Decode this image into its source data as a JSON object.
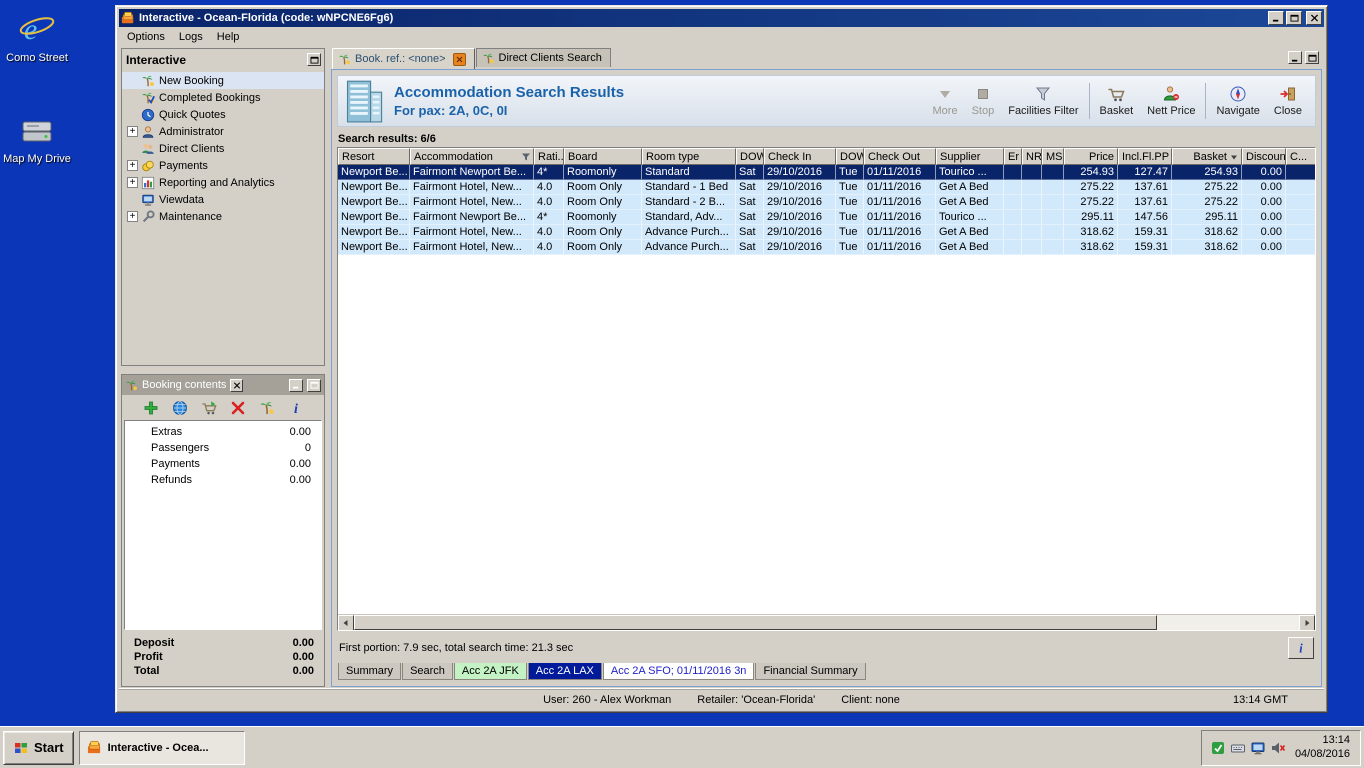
{
  "colors": {
    "desktop": "#0c36b8",
    "titlebar": "#0a246a",
    "selection": "#0a246a",
    "row_blue": "#d2e9fb",
    "header_blue": "#1a62aa"
  },
  "desktop": {
    "icons": [
      {
        "label": "Como Street",
        "name": "desktop-icon-como-street",
        "icon": "ie-icon"
      },
      {
        "label": "Map My Drive",
        "name": "desktop-icon-map-my-drive",
        "icon": "drive-icon"
      }
    ]
  },
  "window": {
    "title": "Interactive - Ocean-Florida (code: wNPCNE6Fg6)",
    "menu": [
      "Options",
      "Logs",
      "Help"
    ]
  },
  "sidebar": {
    "title": "Interactive",
    "items": [
      {
        "label": "New Booking",
        "name": "sidebar-item-new-booking",
        "icon": "new-booking-icon",
        "selected": true
      },
      {
        "label": "Completed Bookings",
        "name": "sidebar-item-completed-bookings",
        "icon": "completed-bookings-icon"
      },
      {
        "label": "Quick Quotes",
        "name": "sidebar-item-quick-quotes",
        "icon": "quick-quotes-icon"
      },
      {
        "label": "Administrator",
        "name": "sidebar-item-administrator",
        "icon": "administrator-icon",
        "expandable": true
      },
      {
        "label": "Direct Clients",
        "name": "sidebar-item-direct-clients",
        "icon": "direct-clients-icon"
      },
      {
        "label": "Payments",
        "name": "sidebar-item-payments",
        "icon": "payments-icon",
        "expandable": true
      },
      {
        "label": "Reporting and Analytics",
        "name": "sidebar-item-reporting-and-analytics",
        "icon": "reporting-icon",
        "expandable": true
      },
      {
        "label": "Viewdata",
        "name": "sidebar-item-viewdata",
        "icon": "viewdata-icon"
      },
      {
        "label": "Maintenance",
        "name": "sidebar-item-maintenance",
        "icon": "maintenance-icon",
        "expandable": true
      }
    ]
  },
  "booking_contents": {
    "title": "Booking contents",
    "toolbar": [
      {
        "icon": "add-icon",
        "name": "add-button"
      },
      {
        "icon": "world-icon",
        "name": "world-button"
      },
      {
        "icon": "basket-move-icon",
        "name": "move-to-basket-button"
      },
      {
        "icon": "delete-icon",
        "name": "delete-button"
      },
      {
        "icon": "palm-icon",
        "name": "palm-button"
      },
      {
        "icon": "info-icon",
        "name": "info-button"
      }
    ],
    "rows": [
      {
        "label": "Extras",
        "value": "0.00"
      },
      {
        "label": "Passengers",
        "value": "0"
      },
      {
        "label": "Payments",
        "value": "0.00"
      },
      {
        "label": "Refunds",
        "value": "0.00"
      }
    ],
    "totals": [
      {
        "label": "Deposit",
        "value": "0.00"
      },
      {
        "label": "Profit",
        "value": "0.00"
      },
      {
        "label": "Total",
        "value": "0.00"
      }
    ]
  },
  "tabs": [
    {
      "label": "Book. ref.: <none>",
      "name": "tab-booking-ref",
      "active": true,
      "closable": true
    },
    {
      "label": "Direct Clients Search",
      "name": "tab-direct-clients-search"
    }
  ],
  "results_header": {
    "title": "Accommodation Search Results",
    "subtitle": "For pax: 2A, 0C, 0I",
    "tools": [
      {
        "label": "More",
        "name": "more-button",
        "icon": "more-icon",
        "disabled": true
      },
      {
        "label": "Stop",
        "name": "stop-button",
        "icon": "stop-icon",
        "disabled": true
      },
      {
        "label": "Facilities Filter",
        "name": "facilities-filter-button",
        "icon": "filter-icon",
        "sep": true
      },
      {
        "label": "Basket",
        "name": "basket-button",
        "icon": "basket-icon"
      },
      {
        "label": "Nett Price",
        "name": "nett-price-button",
        "icon": "nett-price-icon",
        "sep": true
      },
      {
        "label": "Navigate",
        "name": "navigate-button",
        "icon": "navigate-icon"
      },
      {
        "label": "Close",
        "name": "close-search-button",
        "icon": "close-tool-icon"
      }
    ]
  },
  "results": {
    "count_label": "Search results: 6/6",
    "status": "First portion: 7.9 sec, total search time: 21.3 sec",
    "columns": [
      {
        "label": "Resort",
        "name": "col-resort"
      },
      {
        "label": "Accommodation",
        "name": "col-accommodation",
        "filter": true
      },
      {
        "label": "Rati...",
        "name": "col-rating"
      },
      {
        "label": "Board",
        "name": "col-board"
      },
      {
        "label": "Room type",
        "name": "col-room-type"
      },
      {
        "label": "DOW",
        "name": "col-dow-in"
      },
      {
        "label": "Check In",
        "name": "col-check-in"
      },
      {
        "label": "DOW",
        "name": "col-dow-out"
      },
      {
        "label": "Check Out",
        "name": "col-check-out"
      },
      {
        "label": "Supplier",
        "name": "col-supplier"
      },
      {
        "label": "Er",
        "name": "col-er"
      },
      {
        "label": "NR",
        "name": "col-nr"
      },
      {
        "label": "MS",
        "name": "col-ms"
      },
      {
        "label": "Price",
        "name": "col-price",
        "right": true
      },
      {
        "label": "Incl.Fl.PP",
        "name": "col-incl-fl-pp",
        "right": true
      },
      {
        "label": "Basket",
        "name": "col-basket",
        "right": true,
        "sort": true
      },
      {
        "label": "Discount",
        "name": "col-discount",
        "right": true
      },
      {
        "label": "C...",
        "name": "col-c"
      }
    ],
    "rows": [
      {
        "selected": true,
        "resort": "Newport Be...",
        "accommodation": "Fairmont Newport Be...",
        "rating": "4*",
        "board": "Roomonly",
        "room_type": "Standard",
        "dow_in": "Sat",
        "check_in": "29/10/2016",
        "dow_out": "Tue",
        "check_out": "01/11/2016",
        "supplier": "Tourico ...",
        "er": "",
        "nr": "",
        "ms": "",
        "price": "254.93",
        "incl_fl_pp": "127.47",
        "basket": "254.93",
        "discount": "0.00",
        "c": ""
      },
      {
        "resort": "Newport Be...",
        "accommodation": "Fairmont Hotel, New...",
        "rating": "4.0",
        "board": "Room Only",
        "room_type": "Standard - 1 Bed",
        "dow_in": "Sat",
        "check_in": "29/10/2016",
        "dow_out": "Tue",
        "check_out": "01/11/2016",
        "supplier": "Get A Bed",
        "er": "",
        "nr": "",
        "ms": "",
        "price": "275.22",
        "incl_fl_pp": "137.61",
        "basket": "275.22",
        "discount": "0.00",
        "c": ""
      },
      {
        "resort": "Newport Be...",
        "accommodation": "Fairmont Hotel, New...",
        "rating": "4.0",
        "board": "Room Only",
        "room_type": "Standard - 2 B...",
        "dow_in": "Sat",
        "check_in": "29/10/2016",
        "dow_out": "Tue",
        "check_out": "01/11/2016",
        "supplier": "Get A Bed",
        "er": "",
        "nr": "",
        "ms": "",
        "price": "275.22",
        "incl_fl_pp": "137.61",
        "basket": "275.22",
        "discount": "0.00",
        "c": ""
      },
      {
        "resort": "Newport Be...",
        "accommodation": "Fairmont Newport Be...",
        "rating": "4*",
        "board": "Roomonly",
        "room_type": "Standard, Adv...",
        "dow_in": "Sat",
        "check_in": "29/10/2016",
        "dow_out": "Tue",
        "check_out": "01/11/2016",
        "supplier": "Tourico ...",
        "er": "",
        "nr": "",
        "ms": "",
        "price": "295.11",
        "incl_fl_pp": "147.56",
        "basket": "295.11",
        "discount": "0.00",
        "c": ""
      },
      {
        "resort": "Newport Be...",
        "accommodation": "Fairmont Hotel, New...",
        "rating": "4.0",
        "board": "Room Only",
        "room_type": "Advance Purch...",
        "dow_in": "Sat",
        "check_in": "29/10/2016",
        "dow_out": "Tue",
        "check_out": "01/11/2016",
        "supplier": "Get A Bed",
        "er": "",
        "nr": "",
        "ms": "",
        "price": "318.62",
        "incl_fl_pp": "159.31",
        "basket": "318.62",
        "discount": "0.00",
        "c": ""
      },
      {
        "resort": "Newport Be...",
        "accommodation": "Fairmont Hotel, New...",
        "rating": "4.0",
        "board": "Room Only",
        "room_type": "Advance Purch...",
        "dow_in": "Sat",
        "check_in": "29/10/2016",
        "dow_out": "Tue",
        "check_out": "01/11/2016",
        "supplier": "Get A Bed",
        "er": "",
        "nr": "",
        "ms": "",
        "price": "318.62",
        "incl_fl_pp": "159.31",
        "basket": "318.62",
        "discount": "0.00",
        "c": ""
      }
    ]
  },
  "bottom_tabs": [
    {
      "label": "Summary",
      "name": "view-tab-summary",
      "style": "plain"
    },
    {
      "label": "Search",
      "name": "view-tab-search",
      "style": "plain"
    },
    {
      "label": "Acc 2A JFK",
      "name": "view-tab-acc-2a-jfk",
      "style": "green"
    },
    {
      "label": "Acc 2A LAX",
      "name": "view-tab-acc-2a-lax",
      "style": "navy"
    },
    {
      "label": "Acc 2A SFO; 01/11/2016 3n",
      "name": "view-tab-acc-2a-sfo",
      "style": "white"
    },
    {
      "label": "Financial Summary",
      "name": "view-tab-financial-summary",
      "style": "plain"
    }
  ],
  "status_bar": {
    "user": "User: 260 - Alex Workman",
    "retailer": "Retailer: 'Ocean-Florida'",
    "client": "Client: none",
    "time": "13:14 GMT"
  },
  "taskbar": {
    "start_label": "Start",
    "tasks": [
      {
        "label": "Interactive - Ocea...",
        "active": true
      }
    ],
    "tray_icons": [
      {
        "icon": "tray-app-icon"
      },
      {
        "icon": "tray-keyboard-icon"
      },
      {
        "icon": "tray-display-icon"
      },
      {
        "icon": "tray-volume-muted-icon"
      }
    ],
    "clock": {
      "time": "13:14",
      "date": "04/08/2016"
    }
  }
}
